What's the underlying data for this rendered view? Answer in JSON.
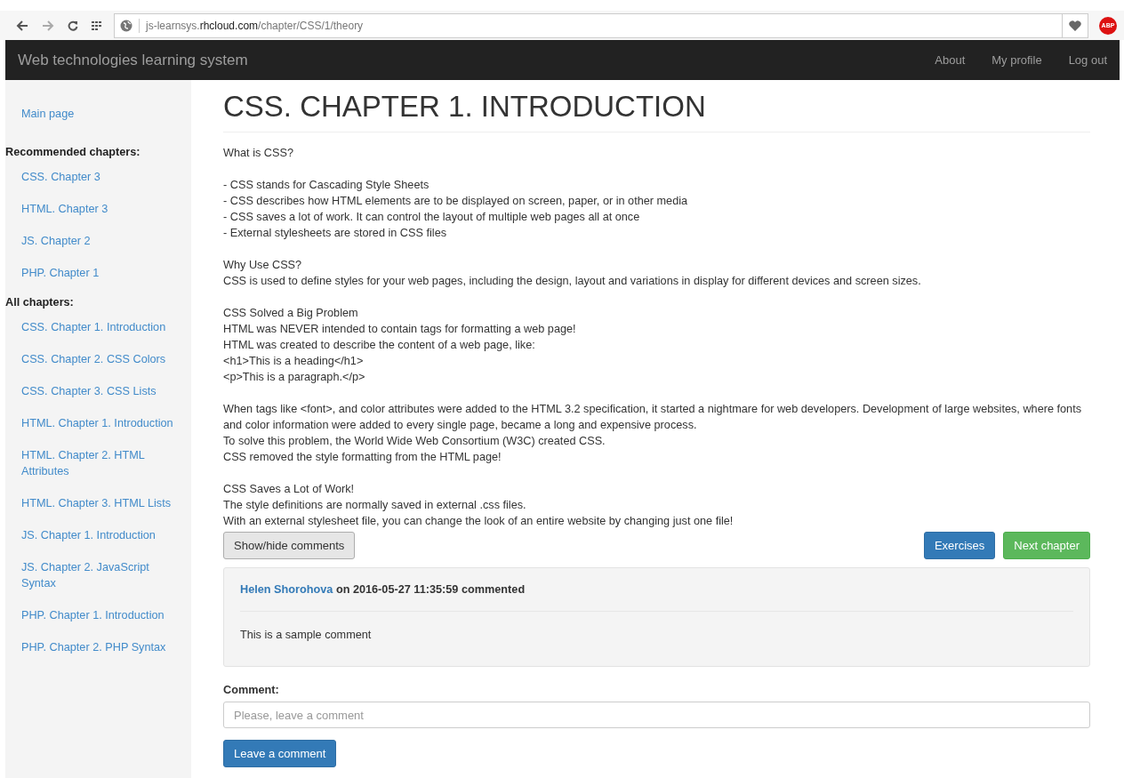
{
  "browser": {
    "url": {
      "subdomain": "js-learnsys.",
      "domain": "rhcloud.com",
      "path": "/chapter/CSS/1/theory"
    },
    "extension_badge": "ABP"
  },
  "navbar": {
    "brand": "Web technologies learning system",
    "links": [
      "About",
      "My profile",
      "Log out"
    ]
  },
  "sidebar": {
    "main_link": "Main page",
    "sections": [
      {
        "title": "Recommended chapters:",
        "items": [
          {
            "label": "CSS. Chapter 3"
          },
          {
            "label": "HTML. Chapter 3"
          },
          {
            "label": "JS. Chapter 2"
          },
          {
            "label": "PHP. Chapter 1"
          }
        ]
      },
      {
        "title": "All chapters:",
        "items": [
          {
            "label": "CSS. Chapter 1. Introduction"
          },
          {
            "label": "CSS. Chapter 2. CSS Colors"
          },
          {
            "label": "CSS. Chapter 3. CSS Lists"
          },
          {
            "label": "HTML. Chapter 1. Introduction"
          },
          {
            "label": "HTML. Chapter 2. HTML Attributes"
          },
          {
            "label": "HTML. Chapter 3. HTML Lists"
          },
          {
            "label": "JS. Chapter 1. Introduction"
          },
          {
            "label": "JS. Chapter 2. JavaScript Syntax"
          },
          {
            "label": "PHP. Chapter 1. Introduction"
          },
          {
            "label": "PHP. Chapter 2. PHP Syntax"
          }
        ]
      }
    ]
  },
  "page_title": "CSS. CHAPTER 1. INTRODUCTION",
  "paragraphs": [
    [
      "What is CSS?"
    ],
    [
      "- CSS stands for Cascading Style Sheets",
      "- CSS describes how HTML elements are to be displayed on screen, paper, or in other media",
      "- CSS saves a lot of work. It can control the layout of multiple web pages all at once",
      "- External stylesheets are stored in CSS files"
    ],
    [
      "Why Use CSS?",
      "CSS is used to define styles for your web pages, including the design, layout and variations in display for different devices and screen sizes."
    ],
    [
      "CSS Solved a Big Problem",
      "HTML was NEVER intended to contain tags for formatting a web page!",
      "HTML was created to describe the content of a web page, like:",
      "<h1>This is a heading</h1>",
      "<p>This is a paragraph.</p>"
    ],
    [
      "When tags like <font>, and color attributes were added to the HTML 3.2 specification, it started a nightmare for web developers. Development of large websites, where fonts and color information were added to every single page, became a long and expensive process.",
      "To solve this problem, the World Wide Web Consortium (W3C) created CSS.",
      "CSS removed the style formatting from the HTML page!"
    ],
    [
      "CSS Saves a Lot of Work!",
      "The style definitions are normally saved in external .css files.",
      "With an external stylesheet file, you can change the look of an entire website by changing just one file!"
    ]
  ],
  "actions": {
    "toggle_comments": "Show/hide comments",
    "exercises": "Exercises",
    "next_chapter": "Next chapter"
  },
  "comments": [
    {
      "author": "Helen Shorohova",
      "meta": "on 2016-05-27 11:35:59 commented",
      "text": "This is a sample comment"
    }
  ],
  "comment_form": {
    "label": "Comment:",
    "placeholder": "Please, leave a comment",
    "submit": "Leave a comment"
  }
}
